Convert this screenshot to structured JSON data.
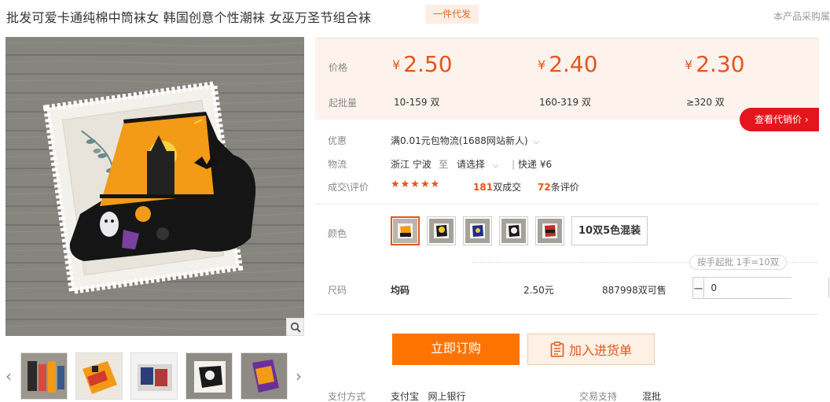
{
  "product": {
    "title": "批发可爱卡通纯棉中筒袜女 韩国创意个性潮袜 女巫万圣节组合袜",
    "tag": "一件代发",
    "top_right_note": "本产品采购属"
  },
  "prices": {
    "price_label": "价格",
    "batch_label": "起批量",
    "currency": "¥",
    "tiers": [
      {
        "price": "2.50",
        "range": "10-159 双"
      },
      {
        "price": "2.40",
        "range": "160-319 双"
      },
      {
        "price": "2.30",
        "range": "≥320 双"
      }
    ],
    "agent_button": "查看代销价 ›"
  },
  "details": {
    "promo_label": "优惠",
    "promo_text": "满0.01元包物流(1688网站新人)",
    "logistics_label": "物流",
    "origin": "浙江 宁波",
    "to": "至",
    "dest_placeholder": "请选择",
    "express": "快递 ¥6",
    "reviews_label": "成交\\评价",
    "stars": "★★★★★",
    "deals_count": "181",
    "deals_unit": "双成交",
    "reviews_count": "72",
    "reviews_unit": "条评价"
  },
  "options": {
    "color_label": "颜色",
    "color_text_option": "10双5色混装",
    "min_batch_note": "按手起批 1手=10双",
    "size_label": "尺码",
    "size_value": "均码",
    "size_price": "2.50元",
    "stock": "887998双可售",
    "quantity": "0",
    "minus": "−",
    "plus": "+"
  },
  "actions": {
    "buy_label": "立即订购",
    "cart_label": "加入进货单"
  },
  "footer": {
    "payment_label": "支付方式",
    "payment_values": "支付宝   网上银行",
    "trade_label": "交易支持",
    "trade_value": "混批"
  },
  "colors": {
    "accent": "#e4551b",
    "buy_bg": "#ff7300",
    "agent_bg": "#e4151c",
    "price_panel_bg": "#fdf3ec"
  }
}
